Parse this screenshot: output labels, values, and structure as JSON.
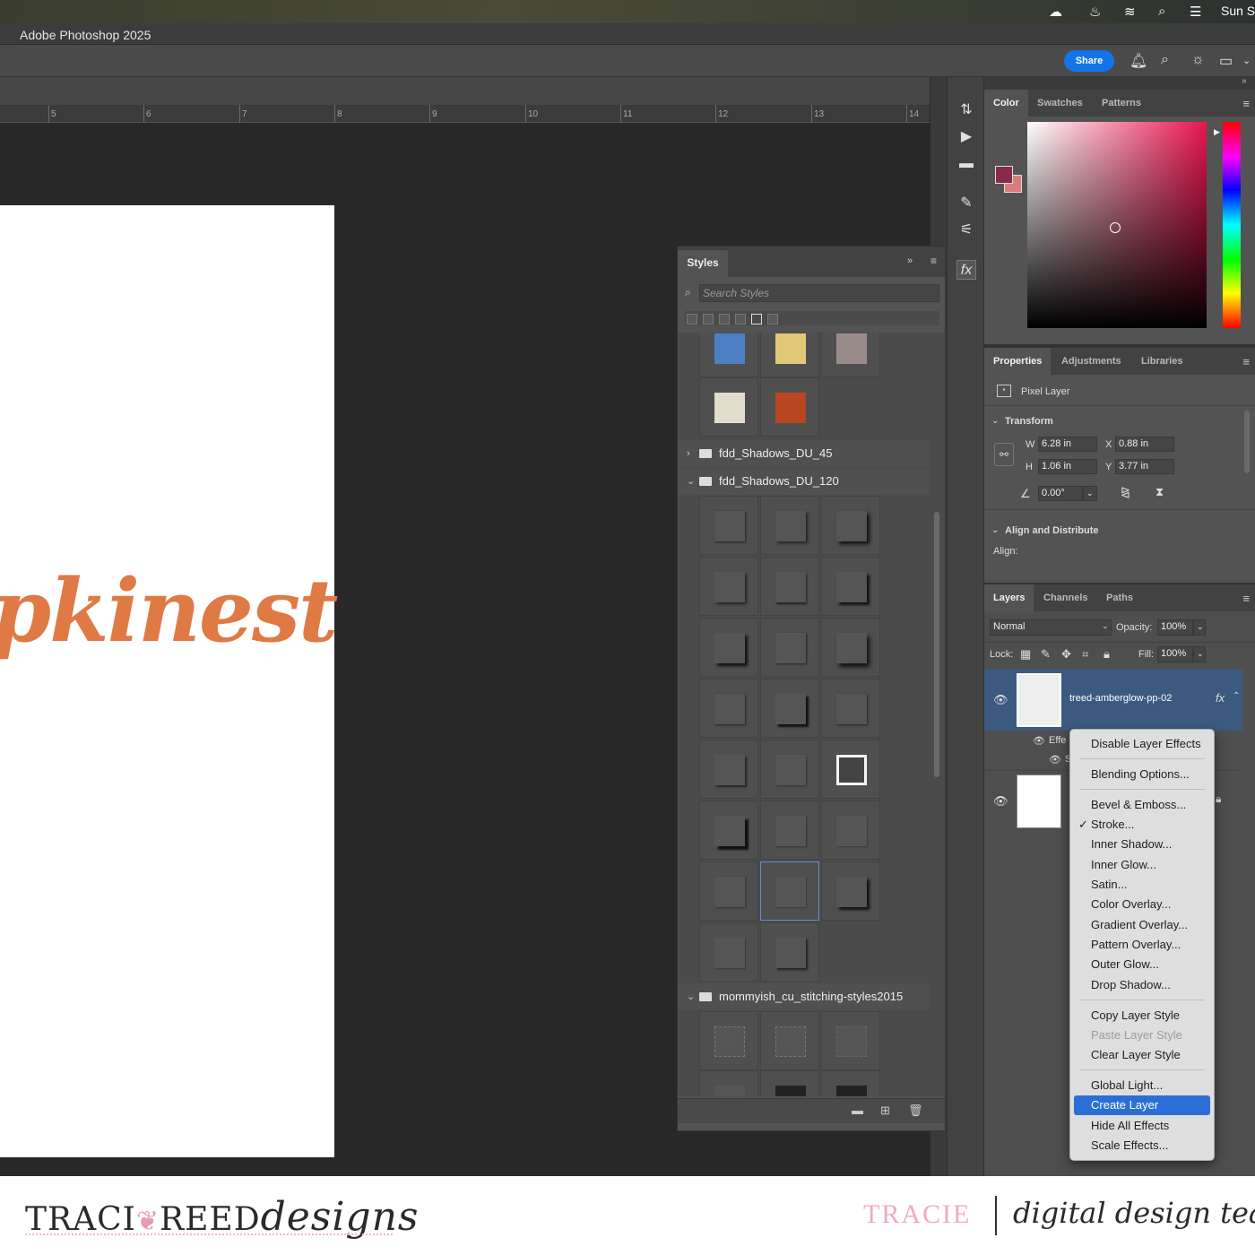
{
  "system_bar": {
    "clock": "Sun S",
    "icons": [
      "creative-cloud-icon",
      "flame-icon",
      "wifi-icon",
      "search-icon",
      "control-center-icon"
    ]
  },
  "app": {
    "title": "Adobe Photoshop 2025"
  },
  "options_bar": {
    "share_label": "Share",
    "icons": [
      "bell-icon",
      "search-icon",
      "lightbulb-icon",
      "workspace-icon"
    ]
  },
  "ruler": {
    "labels": [
      "5",
      "6",
      "7",
      "8",
      "9",
      "10",
      "11",
      "12",
      "13",
      "14"
    ]
  },
  "canvas": {
    "visible_text": "pkinest"
  },
  "styles_panel": {
    "tab": "Styles",
    "search_placeholder": "Search Styles",
    "folders": [
      {
        "name": "fdd_Shadows_DU_45",
        "expanded": false
      },
      {
        "name": "fdd_Shadows_DU_120",
        "expanded": true
      },
      {
        "name": "mommyish_cu_stitching-styles2015",
        "expanded": true
      }
    ]
  },
  "color_panel": {
    "tabs": [
      "Color",
      "Swatches",
      "Patterns"
    ],
    "foreground": "#8a2a4a",
    "background": "#d97c7c"
  },
  "properties_panel": {
    "tabs": [
      "Properties",
      "Adjustments",
      "Libraries"
    ],
    "layer_type": "Pixel Layer",
    "transform_heading": "Transform",
    "w_label": "W",
    "w_value": "6.28 in",
    "h_label": "H",
    "h_value": "1.06 in",
    "x_label": "X",
    "x_value": "0.88 in",
    "y_label": "Y",
    "y_value": "3.77 in",
    "angle_value": "0.00°",
    "align_heading": "Align and Distribute",
    "align_label": "Align:"
  },
  "layers_panel": {
    "tabs": [
      "Layers",
      "Channels",
      "Paths"
    ],
    "blend_mode": "Normal",
    "opacity_label": "Opacity:",
    "opacity_value": "100%",
    "lock_label": "Lock:",
    "fill_label": "Fill:",
    "fill_value": "100%",
    "layer1_name": "treed-amberglow-pp-02",
    "fx_label": "fx",
    "effects_label": "Effe",
    "sub_effect_label": "S"
  },
  "context_menu": {
    "items": [
      {
        "label": "Disable Layer Effects"
      },
      {
        "label": "Blending Options..."
      },
      {
        "label": "Bevel & Emboss..."
      },
      {
        "label": "Stroke...",
        "checked": true
      },
      {
        "label": "Inner Shadow..."
      },
      {
        "label": "Inner Glow..."
      },
      {
        "label": "Satin..."
      },
      {
        "label": "Color Overlay..."
      },
      {
        "label": "Gradient Overlay..."
      },
      {
        "label": "Pattern Overlay..."
      },
      {
        "label": "Outer Glow..."
      },
      {
        "label": "Drop Shadow..."
      },
      {
        "label": "Copy Layer Style"
      },
      {
        "label": "Paste Layer Style",
        "disabled": true
      },
      {
        "label": "Clear Layer Style"
      },
      {
        "label": "Global Light..."
      },
      {
        "label": "Create Layer",
        "highlighted": true
      },
      {
        "label": "Hide All Effects"
      },
      {
        "label": "Scale Effects..."
      }
    ]
  },
  "banner": {
    "brand_left": "TRACI",
    "brand_right": "REED",
    "brand_script": "designs",
    "name": "TRACIE",
    "tagline": "digital design team"
  },
  "colors": {
    "accent": "#1473e6",
    "menu_highlight": "#2b6fd6",
    "canvas_text": "#e07a45",
    "brand_pink": "#f3a9c2"
  }
}
